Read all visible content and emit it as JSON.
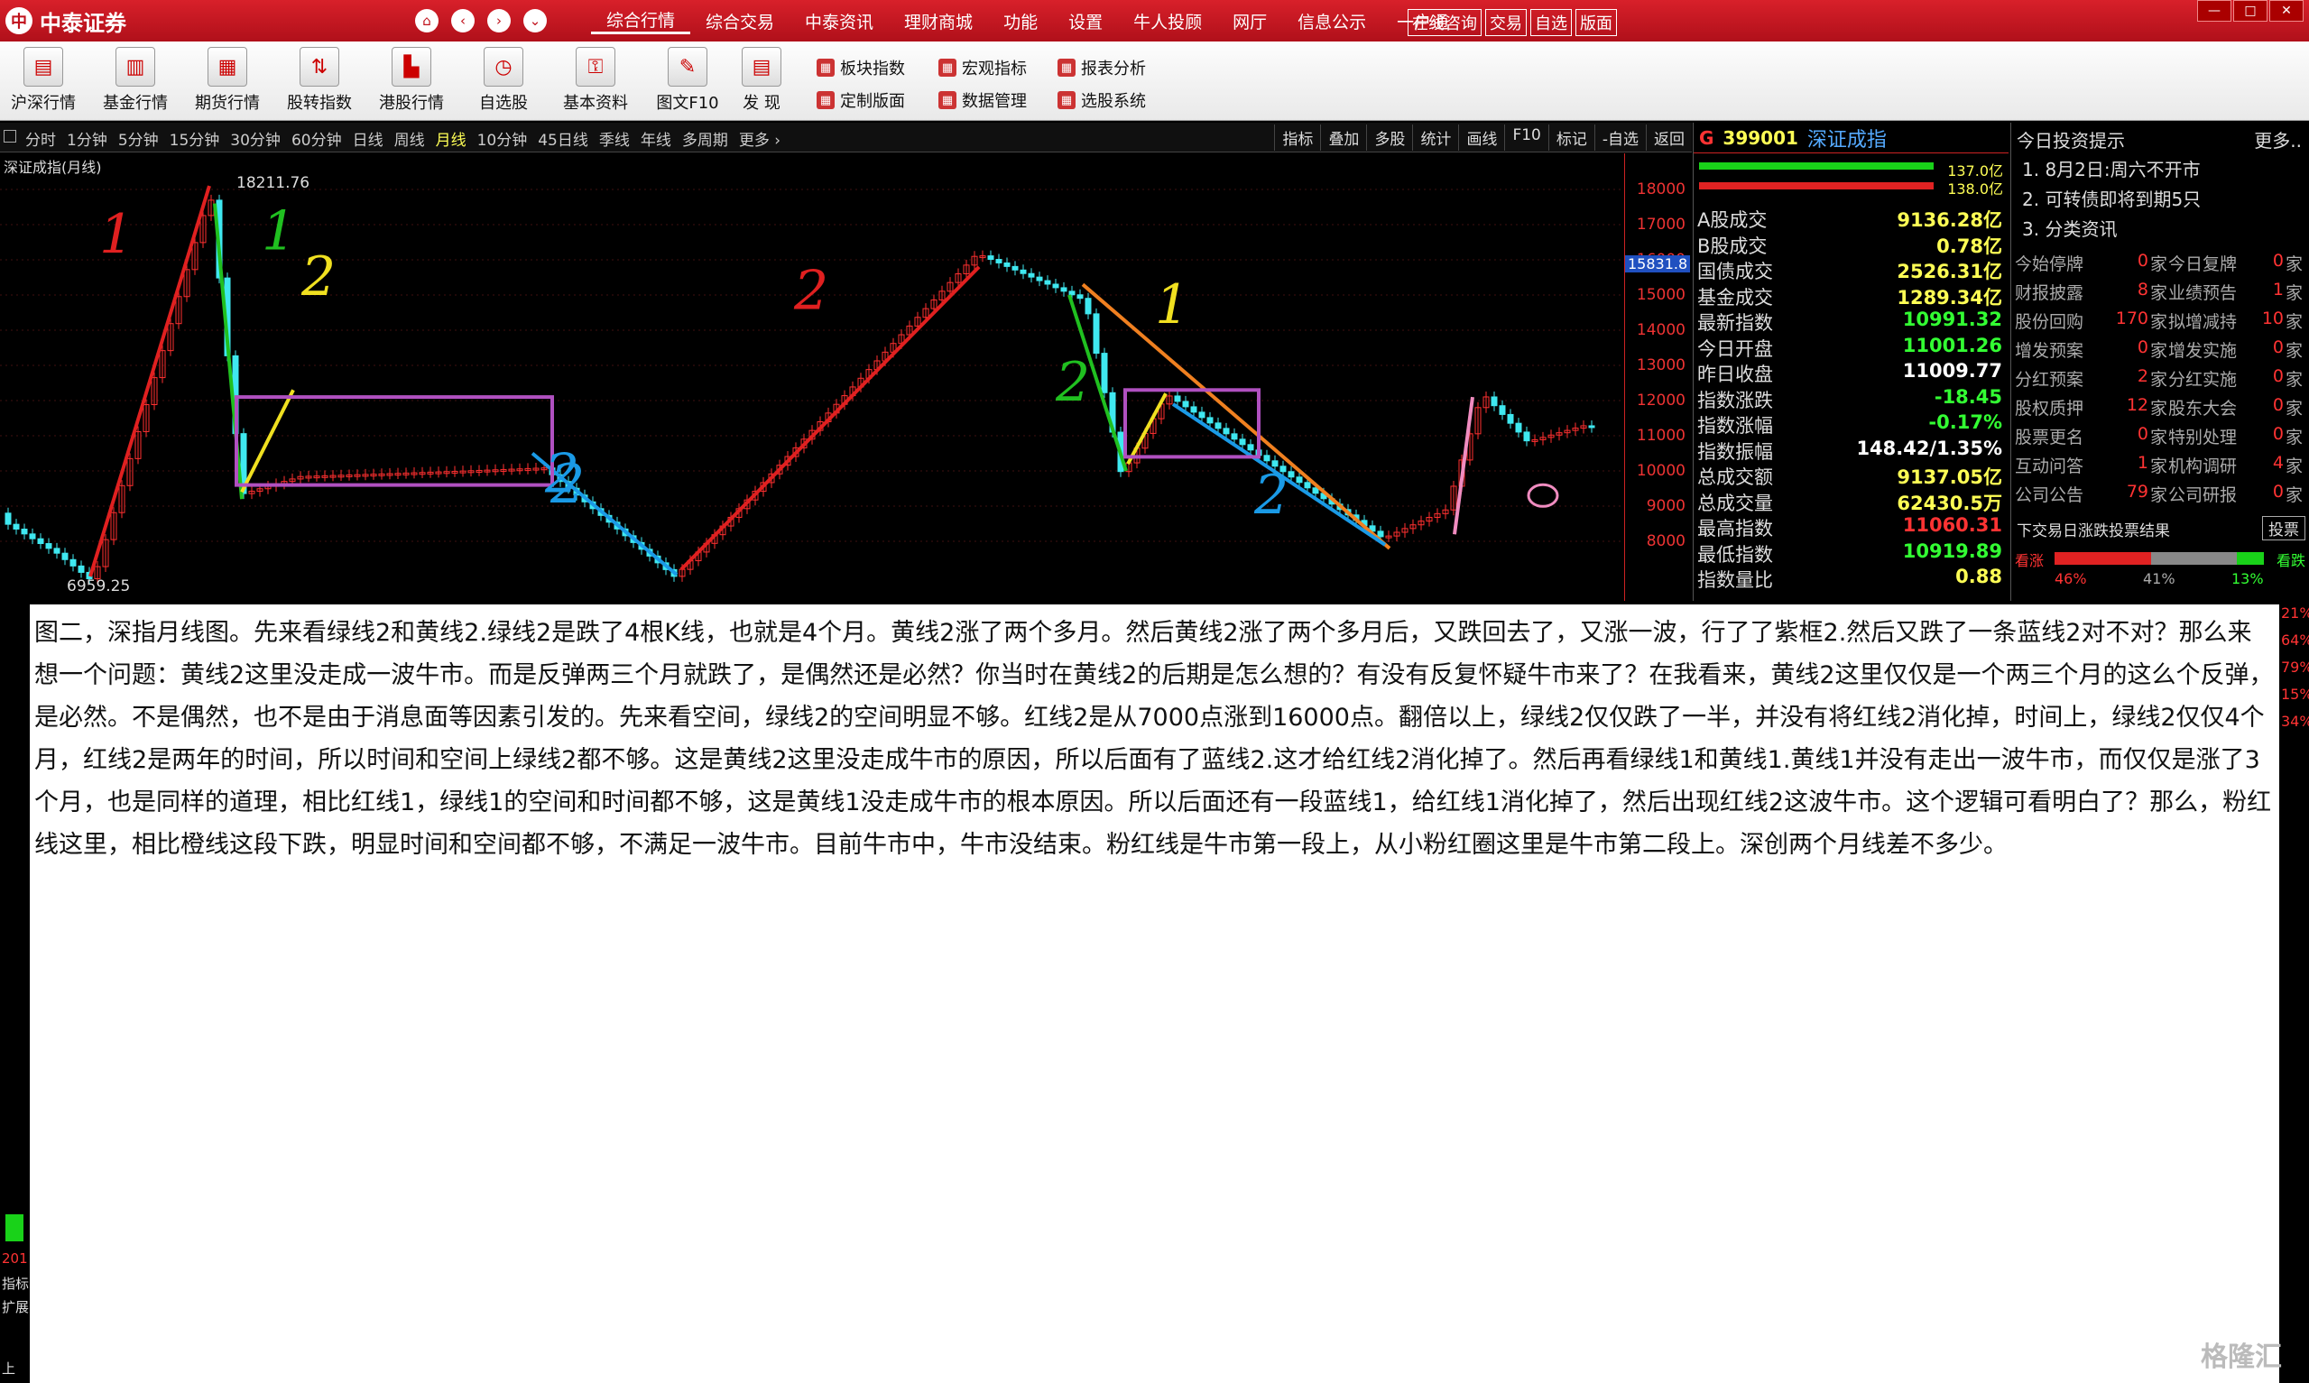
{
  "app": {
    "logo": "中泰证券",
    "logo_mark": "中"
  },
  "nav": {
    "home": "⌂",
    "back": "‹",
    "forward": "›",
    "down": "⌄"
  },
  "menu": [
    "综合行情",
    "综合交易",
    "中泰资讯",
    "理财商城",
    "功能",
    "设置",
    "牛人投顾",
    "网厅",
    "信息公示",
    "一户通"
  ],
  "quick": [
    "在线咨询",
    "交易",
    "自选",
    "版面"
  ],
  "window_controls": [
    "—",
    "□",
    "✕"
  ],
  "toolbar": {
    "big": [
      "沪深行情",
      "基金行情",
      "期货行情",
      "股转指数",
      "港股行情",
      "自选股",
      "基本资料",
      "图文F10",
      "发 现"
    ],
    "small": [
      [
        "板块指数",
        "定制版面"
      ],
      [
        "宏观指标",
        "数据管理"
      ],
      [
        "报表分析",
        "选股系统"
      ]
    ]
  },
  "periods": [
    "分时",
    "1分钟",
    "5分钟",
    "15分钟",
    "30分钟",
    "60分钟",
    "日线",
    "周线",
    "月线",
    "10分钟",
    "45日线",
    "季线",
    "年线",
    "多周期",
    "更多 ›"
  ],
  "active_period": "月线",
  "chart_tools": [
    "指标",
    "叠加",
    "多股",
    "统计",
    "画线",
    "F10",
    "标记",
    "-自选",
    "返回"
  ],
  "chart": {
    "title": "深证成指(月线)",
    "high_label": "18211.76",
    "low_label": "6959.25",
    "current_price": "15831.8",
    "y_ticks": [
      "18000",
      "17000",
      "16000",
      "15000",
      "14000",
      "13000",
      "12000",
      "11000",
      "10000",
      "9000",
      "8000"
    ],
    "annotations": [
      "1",
      "1",
      "2",
      "2",
      "2",
      "2",
      "1",
      "2",
      "2"
    ]
  },
  "quote": {
    "g": "G",
    "code": "399001",
    "name": "深证成指",
    "bar_values": [
      "137.0亿",
      "138.0亿"
    ],
    "rows": [
      {
        "label": "A股成交",
        "value": "9136.28亿",
        "color": "#ffff55"
      },
      {
        "label": "B股成交",
        "value": "0.78亿",
        "color": "#ffff55"
      },
      {
        "label": "国债成交",
        "value": "2526.31亿",
        "color": "#ffff55"
      },
      {
        "label": "基金成交",
        "value": "1289.34亿",
        "color": "#ffff55"
      },
      {
        "label": "最新指数",
        "value": "10991.32",
        "color": "#33ff33"
      },
      {
        "label": "今日开盘",
        "value": "11001.26",
        "color": "#33ff33"
      },
      {
        "label": "昨日收盘",
        "value": "11009.77",
        "color": "#ffffff"
      },
      {
        "label": "指数涨跌",
        "value": "-18.45",
        "color": "#33ff33"
      },
      {
        "label": "指数涨幅",
        "value": "-0.17%",
        "color": "#33ff33"
      },
      {
        "label": "指数振幅",
        "value": "148.42/1.35%",
        "color": "#ffffff"
      },
      {
        "label": "总成交额",
        "value": "9137.05亿",
        "color": "#ffff55"
      },
      {
        "label": "总成交量",
        "value": "62430.5万",
        "color": "#ffff55"
      },
      {
        "label": "最高指数",
        "value": "11060.31",
        "color": "#ff3333"
      },
      {
        "label": "最低指数",
        "value": "10919.89",
        "color": "#33ff33"
      },
      {
        "label": "指数量比",
        "value": "0.88",
        "color": "#ffff55"
      }
    ]
  },
  "news": {
    "title": "今日投资提示",
    "more": "更多..",
    "items": [
      "1. 8月2日:周六不开市",
      "2. 可转债即将到期5只",
      "3. 分类资讯"
    ],
    "stats": [
      [
        "今始停牌",
        "0",
        "今日复牌",
        "0"
      ],
      [
        "财报披露",
        "8",
        "业绩预告",
        "1"
      ],
      [
        "股份回购",
        "170",
        "拟增减持",
        "10"
      ],
      [
        "增发预案",
        "0",
        "增发实施",
        "0"
      ],
      [
        "分红预案",
        "2",
        "分红实施",
        "0"
      ],
      [
        "股权质押",
        "12",
        "股东大会",
        "0"
      ],
      [
        "股票更名",
        "0",
        "特别处理",
        "0"
      ],
      [
        "互动问答",
        "1",
        "机构调研",
        "4"
      ],
      [
        "公司公告",
        "79",
        "公司研报",
        "0"
      ]
    ],
    "unit": "家",
    "vote_title": "下交易日涨跌投票结果",
    "vote_button": "投票",
    "vote": {
      "bull_label": "看涨",
      "bear_label": "看跌",
      "bull": "46%",
      "mid": "41%",
      "bear": "13%"
    },
    "edge_values": [
      "21%",
      "64%",
      "79%",
      "15%",
      "34%"
    ]
  },
  "note": {
    "text": "图二，深指月线图。先来看绿线2和黄线2.绿线2是跌了4根K线，也就是4个月。黄线2涨了两个多月。然后黄线2涨了两个多月后，又跌回去了，又涨一波，行了了紫框2.然后又跌了一条蓝线2对不对？那么来想一个问题：黄线2这里没走成一波牛市。而是反弹两三个月就跌了，是偶然还是必然？你当时在黄线2的后期是怎么想的？有没有反复怀疑牛市来了？在我看来，黄线2这里仅仅是一个两三个月的这么个反弹，是必然。不是偶然，也不是由于消息面等因素引发的。先来看空间，绿线2的空间明显不够。红线2是从7000点涨到16000点。翻倍以上，绿线2仅仅跌了一半，并没有将红线2消化掉，时间上，绿线2仅仅4个月，红线2是两年的时间，所以时间和空间上绿线2都不够。这是黄线2这里没走成牛市的原因，所以后面有了蓝线2.这才给红线2消化掉了。然后再看绿线1和黄线1.黄线1并没有走出一波牛市，而仅仅是涨了3个月，也是同样的道理，相比红线1，绿线1的空间和时间都不够，这是黄线1没走成牛市的根本原因。所以后面还有一段蓝线1，给红线1消化掉了，然后出现红线2这波牛市。这个逻辑可看明白了？那么，粉红线这里，相比橙线这段下跌，明显时间和空间都不够，不满足一波牛市。目前牛市中，牛市没结束。粉红线是牛市第一段上，从小粉红圈这里是牛市第二段上。深创两个月线差不多少。"
  },
  "left_strip": [
    "201",
    "指标",
    "扩展",
    "上"
  ],
  "watermark": "格隆汇"
}
